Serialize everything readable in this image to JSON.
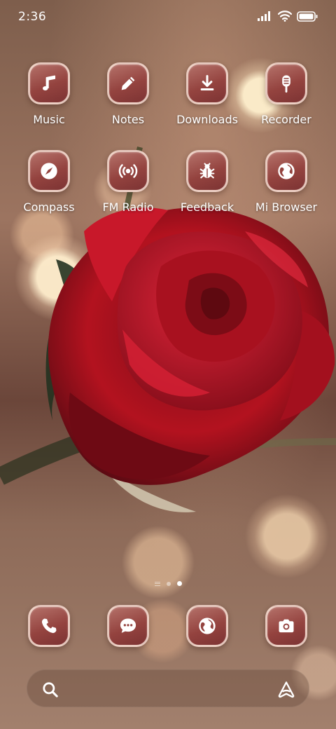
{
  "status": {
    "time": "2:36"
  },
  "apps": [
    {
      "id": "music",
      "label": "Music",
      "icon": "music-note-icon"
    },
    {
      "id": "notes",
      "label": "Notes",
      "icon": "pencil-icon"
    },
    {
      "id": "downloads",
      "label": "Downloads",
      "icon": "download-icon"
    },
    {
      "id": "recorder",
      "label": "Recorder",
      "icon": "microphone-icon"
    },
    {
      "id": "compass",
      "label": "Compass",
      "icon": "compass-icon"
    },
    {
      "id": "fm-radio",
      "label": "FM Radio",
      "icon": "radio-waves-icon"
    },
    {
      "id": "feedback",
      "label": "Feedback",
      "icon": "bug-icon"
    },
    {
      "id": "mi-browser",
      "label": "Mi Browser",
      "icon": "globe-icon"
    }
  ],
  "dock": [
    {
      "id": "phone",
      "icon": "phone-icon"
    },
    {
      "id": "messages",
      "icon": "chat-bubble-icon"
    },
    {
      "id": "browser",
      "icon": "globe-icon"
    },
    {
      "id": "camera",
      "icon": "camera-icon"
    }
  ],
  "pages": {
    "count": 2,
    "current": 2
  },
  "theme": {
    "icon_bg": "#94433f",
    "icon_border": "#ffeee1"
  }
}
